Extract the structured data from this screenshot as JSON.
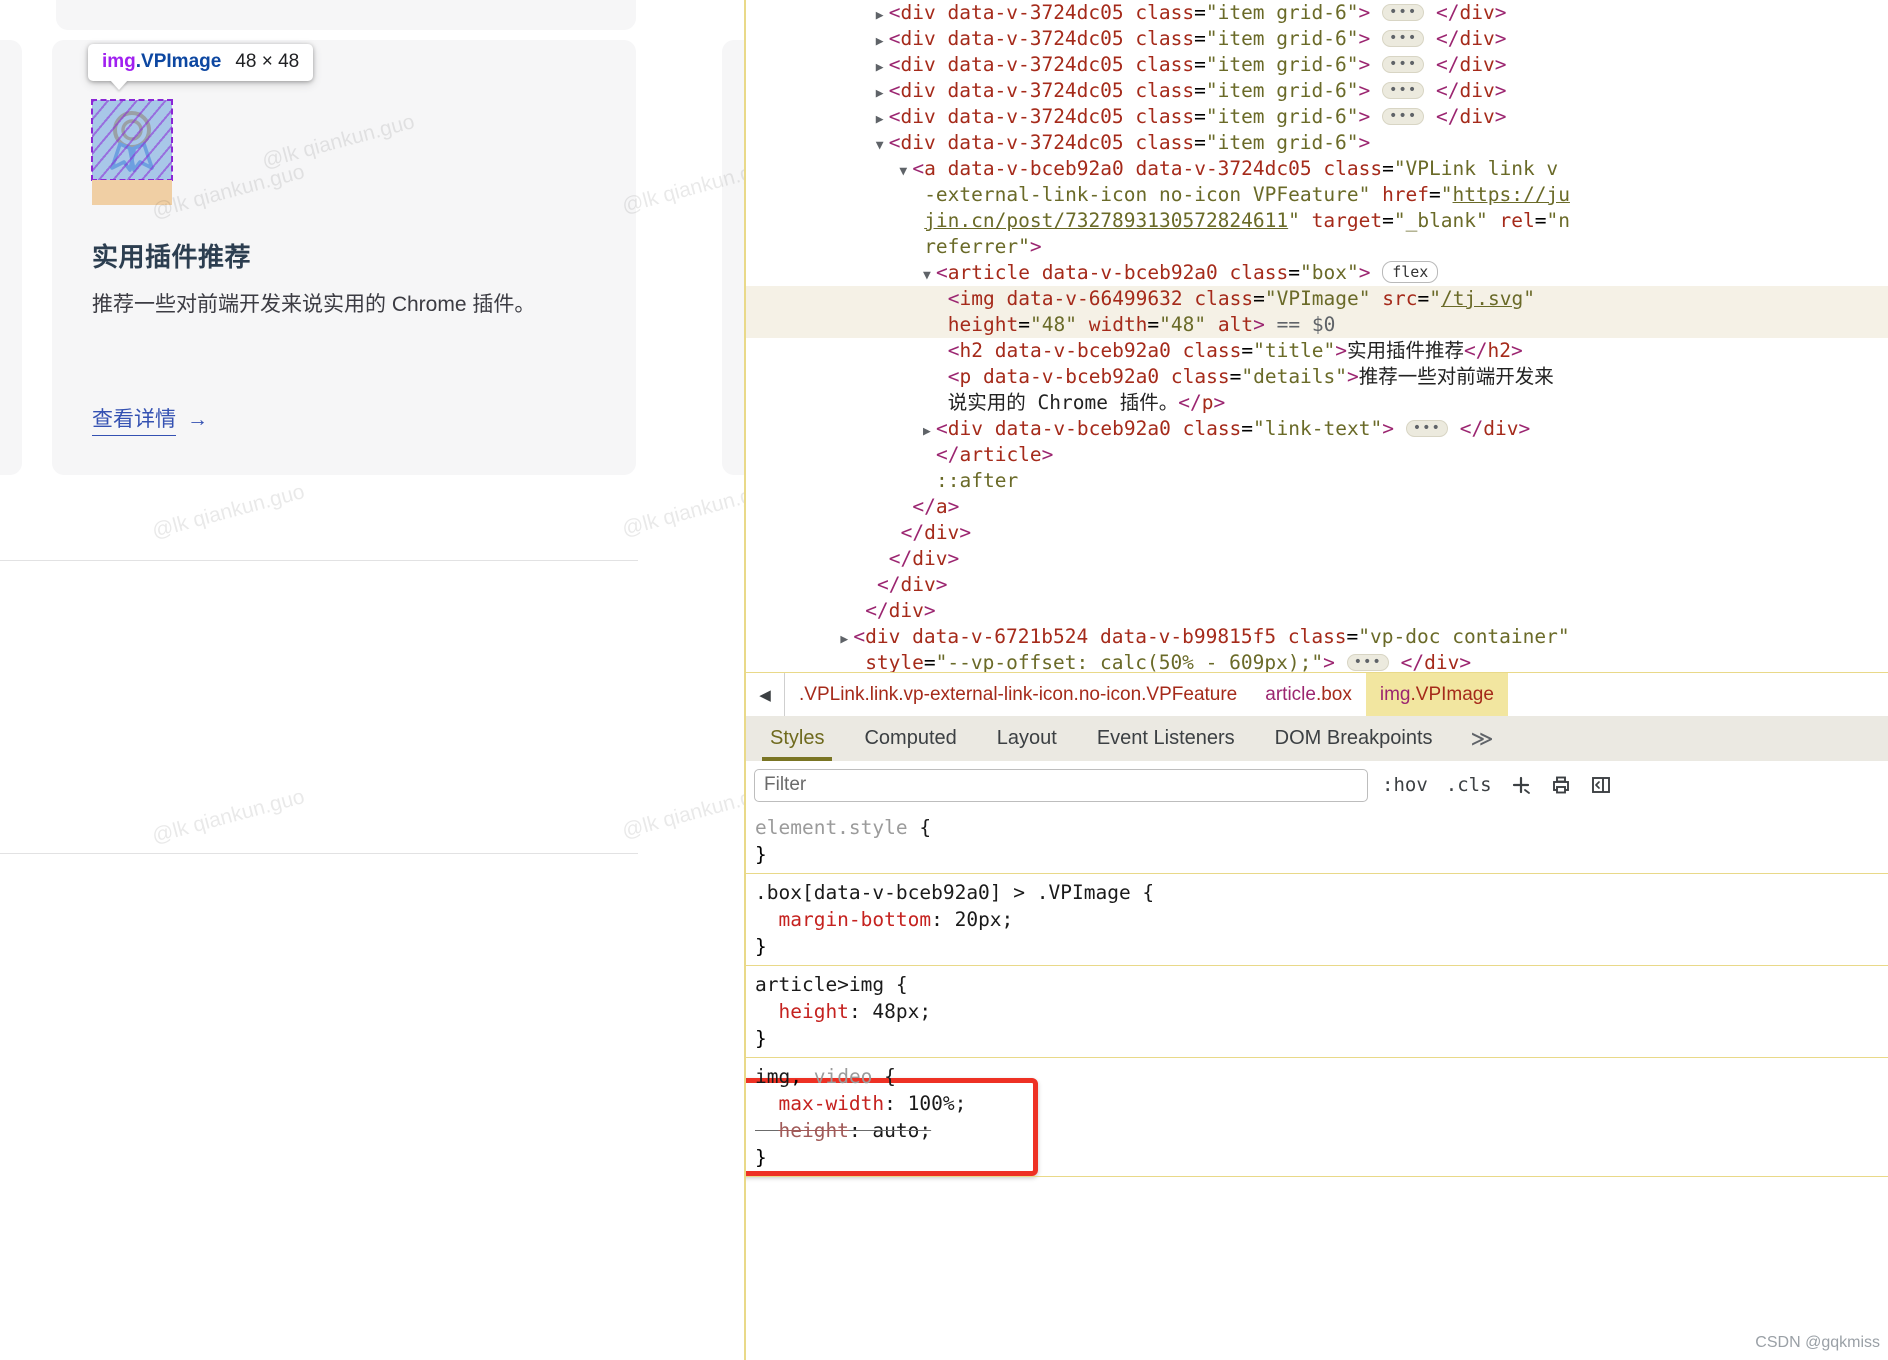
{
  "page": {
    "tooltip": {
      "tag": "img",
      "class": ".VPImage",
      "dimensions": "48 × 48"
    },
    "card": {
      "title": "实用插件推荐",
      "description": "推荐一些对前端开发来说实用的 Chrome 插件。",
      "link_label": "查看详情",
      "link_arrow": "→"
    },
    "watermarks": [
      "@lk qiankun.guo",
      "@lk qiankun.guo",
      "@lk qiankun.guo",
      "@lk qiankun.guo",
      "@lk qiankun.guo",
      "@lk qiankun.guo",
      "@lk qiankun.guo"
    ]
  },
  "devtools": {
    "dom_lines": [
      {
        "indent": 11,
        "arrow": "▶",
        "html": "<span class=\"punc\">&lt;</span><span class=\"tag\">div</span> <span class=\"attr\">data-v-3724dc05</span> <span class=\"attr\">class</span>=<span class=\"val\">\"item grid-6\"</span><span class=\"punc\">&gt;</span> <span class=\"ellip\">•••</span> <span class=\"punc\">&lt;/</span><span class=\"tag\">div</span><span class=\"punc\">&gt;</span>"
      },
      {
        "indent": 11,
        "arrow": "▶",
        "html": "<span class=\"punc\">&lt;</span><span class=\"tag\">div</span> <span class=\"attr\">data-v-3724dc05</span> <span class=\"attr\">class</span>=<span class=\"val\">\"item grid-6\"</span><span class=\"punc\">&gt;</span> <span class=\"ellip\">•••</span> <span class=\"punc\">&lt;/</span><span class=\"tag\">div</span><span class=\"punc\">&gt;</span>"
      },
      {
        "indent": 11,
        "arrow": "▶",
        "html": "<span class=\"punc\">&lt;</span><span class=\"tag\">div</span> <span class=\"attr\">data-v-3724dc05</span> <span class=\"attr\">class</span>=<span class=\"val\">\"item grid-6\"</span><span class=\"punc\">&gt;</span> <span class=\"ellip\">•••</span> <span class=\"punc\">&lt;/</span><span class=\"tag\">div</span><span class=\"punc\">&gt;</span>"
      },
      {
        "indent": 11,
        "arrow": "▶",
        "html": "<span class=\"punc\">&lt;</span><span class=\"tag\">div</span> <span class=\"attr\">data-v-3724dc05</span> <span class=\"attr\">class</span>=<span class=\"val\">\"item grid-6\"</span><span class=\"punc\">&gt;</span> <span class=\"ellip\">•••</span> <span class=\"punc\">&lt;/</span><span class=\"tag\">div</span><span class=\"punc\">&gt;</span>"
      },
      {
        "indent": 11,
        "arrow": "▶",
        "html": "<span class=\"punc\">&lt;</span><span class=\"tag\">div</span> <span class=\"attr\">data-v-3724dc05</span> <span class=\"attr\">class</span>=<span class=\"val\">\"item grid-6\"</span><span class=\"punc\">&gt;</span> <span class=\"ellip\">•••</span> <span class=\"punc\">&lt;/</span><span class=\"tag\">div</span><span class=\"punc\">&gt;</span>"
      },
      {
        "indent": 11,
        "arrow": "▼",
        "html": "<span class=\"punc\">&lt;</span><span class=\"tag\">div</span> <span class=\"attr\">data-v-3724dc05</span> <span class=\"attr\">class</span>=<span class=\"val\">\"item grid-6\"</span><span class=\"punc\">&gt;</span>"
      },
      {
        "indent": 13,
        "arrow": "▼",
        "html": "<span class=\"punc\">&lt;</span><span class=\"tag\">a</span> <span class=\"attr\">data-v-bceb92a0</span> <span class=\"attr\">data-v-3724dc05</span> <span class=\"attr\">class</span>=<span class=\"val\">\"VPLink link v</span>"
      },
      {
        "indent": 14,
        "arrow": "",
        "html": "<span class=\"val\">-external-link-icon no-icon VPFeature\"</span> <span class=\"attr\">href</span>=<span class=\"val\">\"</span><span class=\"lnk\">https://ju</span>"
      },
      {
        "indent": 14,
        "arrow": "",
        "html": "<span class=\"lnk\">jin.cn/post/7327893130572824611</span><span class=\"val\">\"</span> <span class=\"attr\">target</span>=<span class=\"val\">\"_blank\"</span> <span class=\"attr\">rel</span>=<span class=\"val\">\"n</span>"
      },
      {
        "indent": 14,
        "arrow": "",
        "html": "<span class=\"val\">referrer\"</span><span class=\"punc\">&gt;</span>"
      },
      {
        "indent": 15,
        "arrow": "▼",
        "html": "<span class=\"punc\">&lt;</span><span class=\"tag\">article</span> <span class=\"attr\">data-v-bceb92a0</span> <span class=\"attr\">class</span>=<span class=\"val\">\"box\"</span><span class=\"punc\">&gt;</span> <span class=\"flexbadge\">flex</span>"
      },
      {
        "indent": 16,
        "arrow": "",
        "sel": true,
        "html": "<span class=\"punc\">&lt;</span><span class=\"tag\">img</span> <span class=\"attr\">data-v-66499632</span> <span class=\"attr\">class</span>=<span class=\"val\">\"VPImage\"</span> <span class=\"attr\">src</span>=<span class=\"val\">\"</span><span class=\"lnk\">/tj.svg</span><span class=\"val\">\"</span>"
      },
      {
        "indent": 16,
        "arrow": "",
        "sel": true,
        "html": "<span class=\"attr\">height</span>=<span class=\"val\">\"48\"</span> <span class=\"attr\">width</span>=<span class=\"val\">\"48\"</span> <span class=\"attr\">alt</span><span class=\"punc\">&gt;</span> <span class=\"grey\">== $0</span>"
      },
      {
        "indent": 16,
        "arrow": "",
        "html": "<span class=\"punc\">&lt;</span><span class=\"tag\">h2</span> <span class=\"attr\">data-v-bceb92a0</span> <span class=\"attr\">class</span>=<span class=\"val\">\"title\"</span><span class=\"punc\">&gt;</span><span class=\"txt\">实用插件推荐</span><span class=\"punc\">&lt;/</span><span class=\"tag\">h2</span><span class=\"punc\">&gt;</span>"
      },
      {
        "indent": 16,
        "arrow": "",
        "html": "<span class=\"punc\">&lt;</span><span class=\"tag\">p</span> <span class=\"attr\">data-v-bceb92a0</span> <span class=\"attr\">class</span>=<span class=\"val\">\"details\"</span><span class=\"punc\">&gt;</span><span class=\"txt\">推荐一些对前端开发来</span>"
      },
      {
        "indent": 16,
        "arrow": "",
        "html": "<span class=\"txt\">说实用的 Chrome 插件。</span><span class=\"punc\">&lt;/</span><span class=\"tag\">p</span><span class=\"punc\">&gt;</span>"
      },
      {
        "indent": 15,
        "arrow": "▶",
        "html": "<span class=\"punc\">&lt;</span><span class=\"tag\">div</span> <span class=\"attr\">data-v-bceb92a0</span> <span class=\"attr\">class</span>=<span class=\"val\">\"link-text\"</span><span class=\"punc\">&gt;</span> <span class=\"ellip\">•••</span> <span class=\"punc\">&lt;/</span><span class=\"tag\">div</span><span class=\"punc\">&gt;</span>"
      },
      {
        "indent": 15,
        "arrow": "",
        "html": "<span class=\"punc\">&lt;/</span><span class=\"tag\">article</span><span class=\"punc\">&gt;</span>"
      },
      {
        "indent": 15,
        "arrow": "",
        "html": "<span class=\"val\">::after</span>"
      },
      {
        "indent": 13,
        "arrow": "",
        "html": "<span class=\"punc\">&lt;/</span><span class=\"tag\">a</span><span class=\"punc\">&gt;</span>"
      },
      {
        "indent": 12,
        "arrow": "",
        "html": "<span class=\"punc\">&lt;/</span><span class=\"tag\">div</span><span class=\"punc\">&gt;</span>"
      },
      {
        "indent": 11,
        "arrow": "",
        "html": "<span class=\"punc\">&lt;/</span><span class=\"tag\">div</span><span class=\"punc\">&gt;</span>"
      },
      {
        "indent": 10,
        "arrow": "",
        "html": "<span class=\"punc\">&lt;/</span><span class=\"tag\">div</span><span class=\"punc\">&gt;</span>"
      },
      {
        "indent": 9,
        "arrow": "",
        "html": "<span class=\"punc\">&lt;/</span><span class=\"tag\">div</span><span class=\"punc\">&gt;</span>"
      },
      {
        "indent": 8,
        "arrow": "▶",
        "html": "<span class=\"punc\">&lt;</span><span class=\"tag\">div</span> <span class=\"attr\">data-v-6721b524</span> <span class=\"attr\">data-v-b99815f5</span> <span class=\"attr\">class</span>=<span class=\"val\">\"vp-doc container\"</span>"
      },
      {
        "indent": 9,
        "arrow": "",
        "html": "<span class=\"attr\">style</span>=<span class=\"val\">\"--vp-offset: calc(50% - 609px);\"</span><span class=\"punc\">&gt;</span> <span class=\"ellip\">•••</span> <span class=\"punc\">&lt;/</span><span class=\"tag\">div</span><span class=\"punc\">&gt;</span>"
      }
    ],
    "breadcrumb": {
      "scroll_left_icon": "◀",
      "items": [
        {
          "text": ".VPLink.link.vp-external-link-icon.no-icon.VPFeature",
          "active": false,
          "style": "cls"
        },
        {
          "text": "article.box",
          "active": false,
          "style": "mixed"
        },
        {
          "text": "img.VPImage",
          "active": true,
          "style": "mixed"
        }
      ]
    },
    "tabs": [
      {
        "label": "Styles",
        "active": true
      },
      {
        "label": "Computed",
        "active": false
      },
      {
        "label": "Layout",
        "active": false
      },
      {
        "label": "Event Listeners",
        "active": false
      },
      {
        "label": "DOM Breakpoints",
        "active": false
      }
    ],
    "tabs_overflow": "≫",
    "filter": {
      "value": "",
      "placeholder": "Filter",
      "hov_label": ":hov",
      "cls_label": ".cls",
      "add_rule_icon": "+",
      "print_icon": "print-icon",
      "sidebar_icon": "sidebar-icon"
    },
    "style_rules": [
      {
        "selector_html": "<span class=\"sel-ua\">element.style</span> <span class=\"sel-n\">{</span>",
        "declarations": [],
        "close": "}",
        "source": ""
      },
      {
        "selector_html": "<span class=\"sel-n\">.box[data-v-bceb92a0] &gt; .VPImage {</span>",
        "declarations": [
          {
            "prop": "margin-bottom",
            "value": "20px",
            "struck": false
          }
        ],
        "close": "}",
        "source": "<style"
      },
      {
        "selector_html": "<span class=\"sel-n\">article&gt;img {</span>",
        "declarations": [
          {
            "prop": "height",
            "value": "48px",
            "struck": false
          }
        ],
        "close": "}",
        "source": "<style",
        "highlight": true
      },
      {
        "selector_html": "<span class=\"sel-n\">img</span>, <span class=\"sel-ua\">video</span> <span class=\"sel-n\">{</span>",
        "declarations": [
          {
            "prop": "max-width",
            "value": "100%",
            "struck": false
          },
          {
            "prop": "height",
            "value": "auto",
            "struck": true
          }
        ],
        "close": "}",
        "source": "<style"
      }
    ],
    "footer_credit": "CSDN @gqkmiss"
  }
}
